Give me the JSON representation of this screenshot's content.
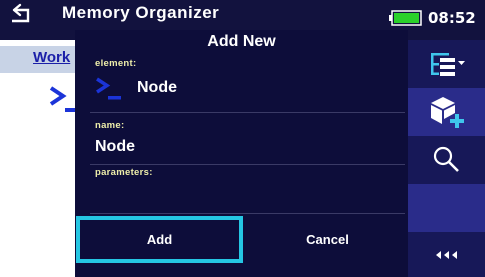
{
  "status_bar": {
    "title": "Memory Organizer",
    "time": "08:52",
    "battery_level": 1.0,
    "battery_color": "#2ad12a"
  },
  "background": {
    "breadcrumb": "Work",
    "node_icon": "terminal-prompt-icon"
  },
  "dialog": {
    "title": "Add New",
    "element_label": "element:",
    "element_value": "Node",
    "element_icon": "terminal-prompt-icon",
    "name_label": "name:",
    "name_value": "Node",
    "parameters_label": "parameters:",
    "add_label": "Add",
    "cancel_label": "Cancel",
    "focus_color": "#25c6e3"
  },
  "sidebar": {
    "items": [
      {
        "icon": "tree-structure-icon"
      },
      {
        "icon": "add-object-icon"
      },
      {
        "icon": "search-icon"
      },
      {
        "icon": "blank"
      },
      {
        "icon": "more-icon",
        "label": "◀◀◀"
      }
    ]
  }
}
